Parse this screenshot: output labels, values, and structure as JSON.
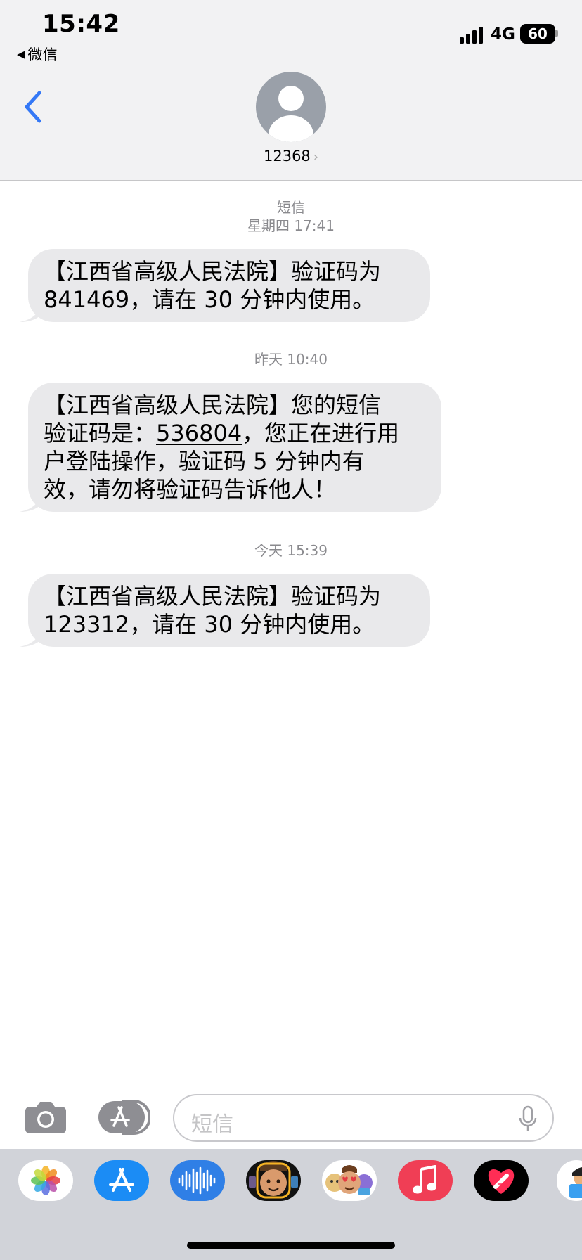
{
  "status_bar": {
    "time": "15:42",
    "back_app": "微信",
    "network": "4G",
    "battery": "60"
  },
  "header": {
    "contact": "12368"
  },
  "thread": {
    "service_label": "短信",
    "groups": [
      {
        "timestamp": "星期四 17:41",
        "line1": "【江西省高级人民法院】验证码为",
        "code": "841469",
        "line2_rest": "，请在 30 分钟内使用。"
      },
      {
        "timestamp": "昨天 10:40",
        "line1": "【江西省高级人民法院】您的短信",
        "line2_pre": "验证码是：",
        "code": "536804",
        "line2_rest": "，您正在进行用",
        "line3": "户登陆操作，验证码 5 分钟内有",
        "line4": "效，请勿将验证码告诉他人！"
      },
      {
        "timestamp": "今天 15:39",
        "line1": "【江西省高级人民法院】验证码为",
        "code": "123312",
        "line2_rest": "，请在 30 分钟内使用。"
      }
    ]
  },
  "input_bar": {
    "placeholder": "短信"
  },
  "app_drawer": {
    "apps": [
      "photos-icon",
      "app-store-icon",
      "audio-waveform-icon",
      "memoji-icon",
      "animoji-icon",
      "music-icon",
      "digital-touch-icon",
      "partial-app-icon"
    ]
  },
  "colors": {
    "accent": "#3478f6",
    "bubble": "#e9e9eb",
    "header_bg": "#f2f2f3",
    "drawer_bg": "#d1d3d9"
  }
}
